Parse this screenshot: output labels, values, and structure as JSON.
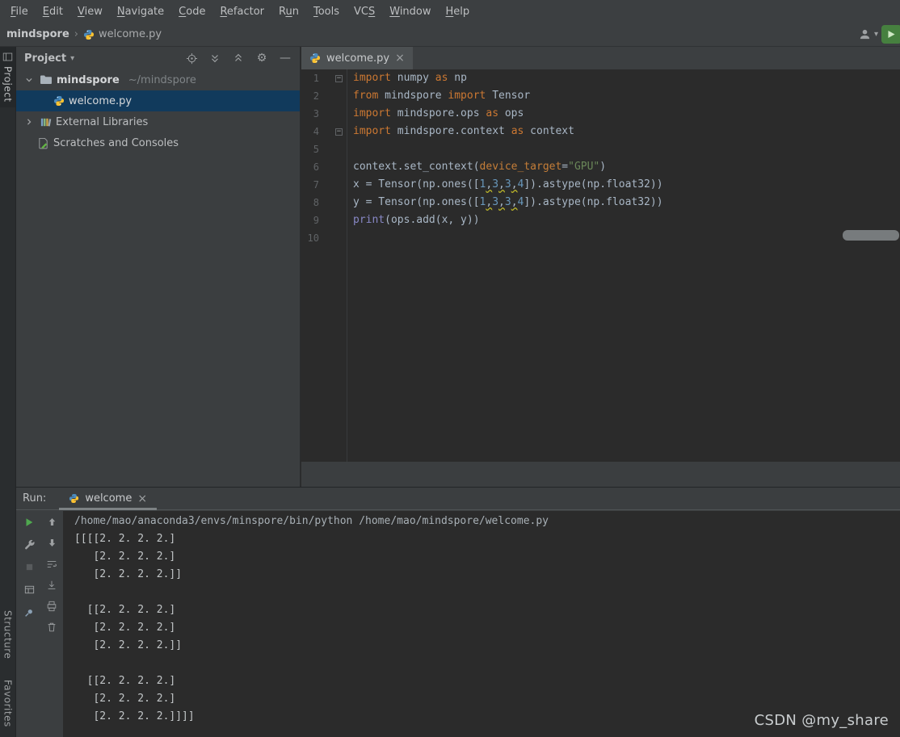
{
  "menu": {
    "items": [
      {
        "label": "File",
        "mnemonic": 0
      },
      {
        "label": "Edit",
        "mnemonic": 0
      },
      {
        "label": "View",
        "mnemonic": 0
      },
      {
        "label": "Navigate",
        "mnemonic": 0
      },
      {
        "label": "Code",
        "mnemonic": 0
      },
      {
        "label": "Refactor",
        "mnemonic": 0
      },
      {
        "label": "Run",
        "mnemonic": 1
      },
      {
        "label": "Tools",
        "mnemonic": 0
      },
      {
        "label": "VCS",
        "mnemonic": 2
      },
      {
        "label": "Window",
        "mnemonic": 0
      },
      {
        "label": "Help",
        "mnemonic": 0
      }
    ]
  },
  "breadcrumb": {
    "project": "mindspore",
    "file": "welcome.py"
  },
  "top_right": {
    "icons": [
      "user-account-icon",
      "chevron-down-icon",
      "corner-plugin-icon"
    ]
  },
  "tool_strip": {
    "project": "Project",
    "structure": "Structure",
    "favorites": "Favorites"
  },
  "project_panel": {
    "title": "Project",
    "header_icons": [
      "locate-icon",
      "expand-all-icon",
      "collapse-all-icon",
      "settings-gear-icon",
      "hide-panel-icon"
    ],
    "tree": {
      "root_name": "mindspore",
      "root_path": "~/mindspore",
      "file": "welcome.py",
      "external_libraries": "External Libraries",
      "scratches": "Scratches and Consoles"
    }
  },
  "editor": {
    "tab": "welcome.py",
    "lines": [
      {
        "num": "1",
        "fold": true,
        "tokens": [
          {
            "t": "import",
            "c": "kw"
          },
          {
            "t": " numpy ",
            "c": "pl"
          },
          {
            "t": "as",
            "c": "kw"
          },
          {
            "t": " np",
            "c": "pl"
          }
        ]
      },
      {
        "num": "2",
        "tokens": [
          {
            "t": "from",
            "c": "kw"
          },
          {
            "t": " mindspore ",
            "c": "pl"
          },
          {
            "t": "import",
            "c": "kw"
          },
          {
            "t": " Tensor",
            "c": "pl"
          }
        ]
      },
      {
        "num": "3",
        "tokens": [
          {
            "t": "import",
            "c": "kw"
          },
          {
            "t": " mindspore.ops ",
            "c": "pl"
          },
          {
            "t": "as",
            "c": "kw"
          },
          {
            "t": " ops",
            "c": "pl"
          }
        ]
      },
      {
        "num": "4",
        "fold": true,
        "tokens": [
          {
            "t": "import",
            "c": "kw"
          },
          {
            "t": " mindspore.context ",
            "c": "pl"
          },
          {
            "t": "as",
            "c": "kw"
          },
          {
            "t": " context",
            "c": "pl"
          }
        ]
      },
      {
        "num": "5",
        "tokens": []
      },
      {
        "num": "6",
        "tokens": [
          {
            "t": "context.set_context(",
            "c": "pl"
          },
          {
            "t": "device_target",
            "c": "par"
          },
          {
            "t": "=",
            "c": "pl"
          },
          {
            "t": "\"GPU\"",
            "c": "str"
          },
          {
            "t": ")",
            "c": "pl"
          }
        ]
      },
      {
        "num": "7",
        "tokens": [
          {
            "t": "x = Tensor(np.ones([",
            "c": "pl"
          },
          {
            "t": "1",
            "c": "num"
          },
          {
            "t": ",",
            "c": "pl",
            "w": true
          },
          {
            "t": "3",
            "c": "num"
          },
          {
            "t": ",",
            "c": "pl",
            "w": true
          },
          {
            "t": "3",
            "c": "num"
          },
          {
            "t": ",",
            "c": "pl",
            "w": true
          },
          {
            "t": "4",
            "c": "num"
          },
          {
            "t": "]).astype(np.float32))",
            "c": "pl"
          }
        ]
      },
      {
        "num": "8",
        "tokens": [
          {
            "t": "y = Tensor(np.ones([",
            "c": "pl"
          },
          {
            "t": "1",
            "c": "num"
          },
          {
            "t": ",",
            "c": "pl",
            "w": true
          },
          {
            "t": "3",
            "c": "num"
          },
          {
            "t": ",",
            "c": "pl",
            "w": true
          },
          {
            "t": "3",
            "c": "num"
          },
          {
            "t": ",",
            "c": "pl",
            "w": true
          },
          {
            "t": "4",
            "c": "num"
          },
          {
            "t": "]).astype(np.float32))",
            "c": "pl"
          }
        ]
      },
      {
        "num": "9",
        "tokens": [
          {
            "t": "print",
            "c": "bi"
          },
          {
            "t": "(ops.add(x, y))",
            "c": "pl"
          }
        ]
      },
      {
        "num": "10",
        "tokens": []
      }
    ]
  },
  "run_panel": {
    "label": "Run:",
    "tab": "welcome",
    "toolbar_left_icons": [
      "rerun-icon",
      "wrench-icon",
      "stop-icon",
      "restore-layout-icon",
      "pin-icon"
    ],
    "toolbar_right_icons": [
      "up-stack-trace-icon",
      "down-stack-trace-icon",
      "soft-wrap-icon",
      "scroll-to-end-icon",
      "print-icon",
      "clear-all-icon"
    ],
    "console": [
      {
        "kind": "cmd",
        "text": "/home/mao/anaconda3/envs/minspore/bin/python /home/mao/mindspore/welcome.py"
      },
      {
        "kind": "out",
        "text": "[[[[2. 2. 2. 2.]"
      },
      {
        "kind": "out",
        "text": "   [2. 2. 2. 2.]"
      },
      {
        "kind": "out",
        "text": "   [2. 2. 2. 2.]]"
      },
      {
        "kind": "out",
        "text": ""
      },
      {
        "kind": "out",
        "text": "  [[2. 2. 2. 2.]"
      },
      {
        "kind": "out",
        "text": "   [2. 2. 2. 2.]"
      },
      {
        "kind": "out",
        "text": "   [2. 2. 2. 2.]]"
      },
      {
        "kind": "out",
        "text": ""
      },
      {
        "kind": "out",
        "text": "  [[2. 2. 2. 2.]"
      },
      {
        "kind": "out",
        "text": "   [2. 2. 2. 2.]"
      },
      {
        "kind": "out",
        "text": "   [2. 2. 2. 2.]]]]"
      }
    ]
  },
  "watermark": "CSDN @my_share",
  "colors": {
    "chrome": "#3C3F41",
    "panel": "#3B3E40",
    "editor": "#2B2B2B",
    "selection": "#113A5C",
    "keyword": "#CC7832",
    "string": "#6A8759",
    "number": "#6897BB",
    "builtin": "#8888C6",
    "param": "#C57E38",
    "code_text": "#A9B7C6",
    "squiggle": "#BBB529",
    "line_number": "#606366",
    "run_green": "#4FA84F"
  }
}
